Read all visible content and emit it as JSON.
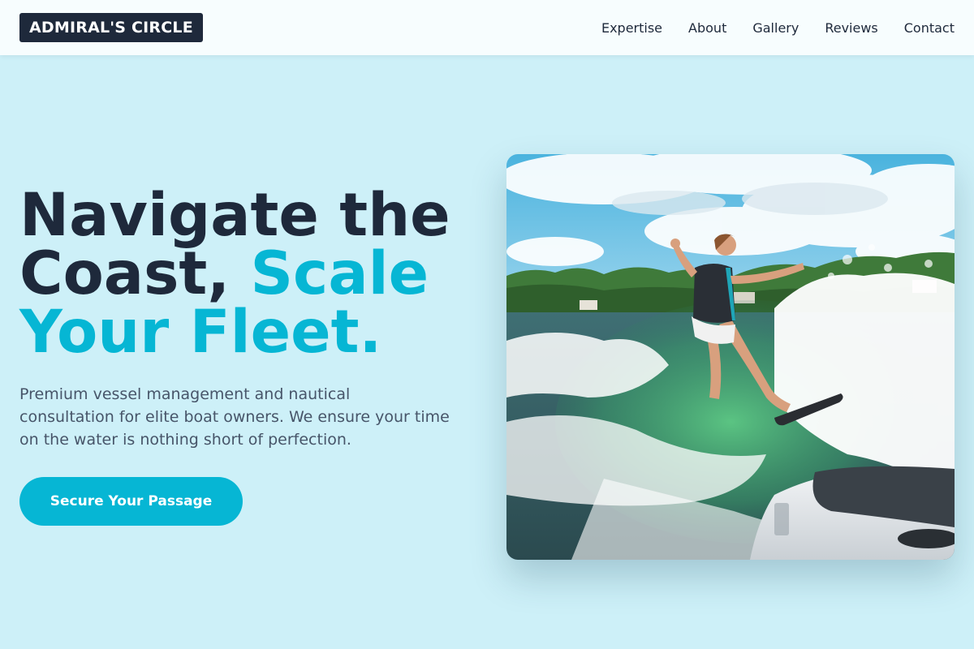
{
  "header": {
    "brand": "ADMIRAL'S CIRCLE",
    "nav": [
      {
        "label": "Expertise"
      },
      {
        "label": "About"
      },
      {
        "label": "Gallery"
      },
      {
        "label": "Reviews"
      },
      {
        "label": "Contact"
      }
    ]
  },
  "hero": {
    "title_line1": "Navigate the",
    "title_line2_plain": "Coast, ",
    "title_line2_accent": "Scale",
    "title_line3_accent": "Your Fleet.",
    "subtitle": "Premium vessel management and nautical consultation for elite boat owners. We ensure your time on the water is nothing short of perfection.",
    "cta_label": "Secure Your Passage",
    "image_subject": "wakesurfer-photo"
  },
  "colors": {
    "background": "#cdf0f8",
    "dark": "#1e293b",
    "accent": "#06b6d4",
    "muted_text": "#475569"
  }
}
